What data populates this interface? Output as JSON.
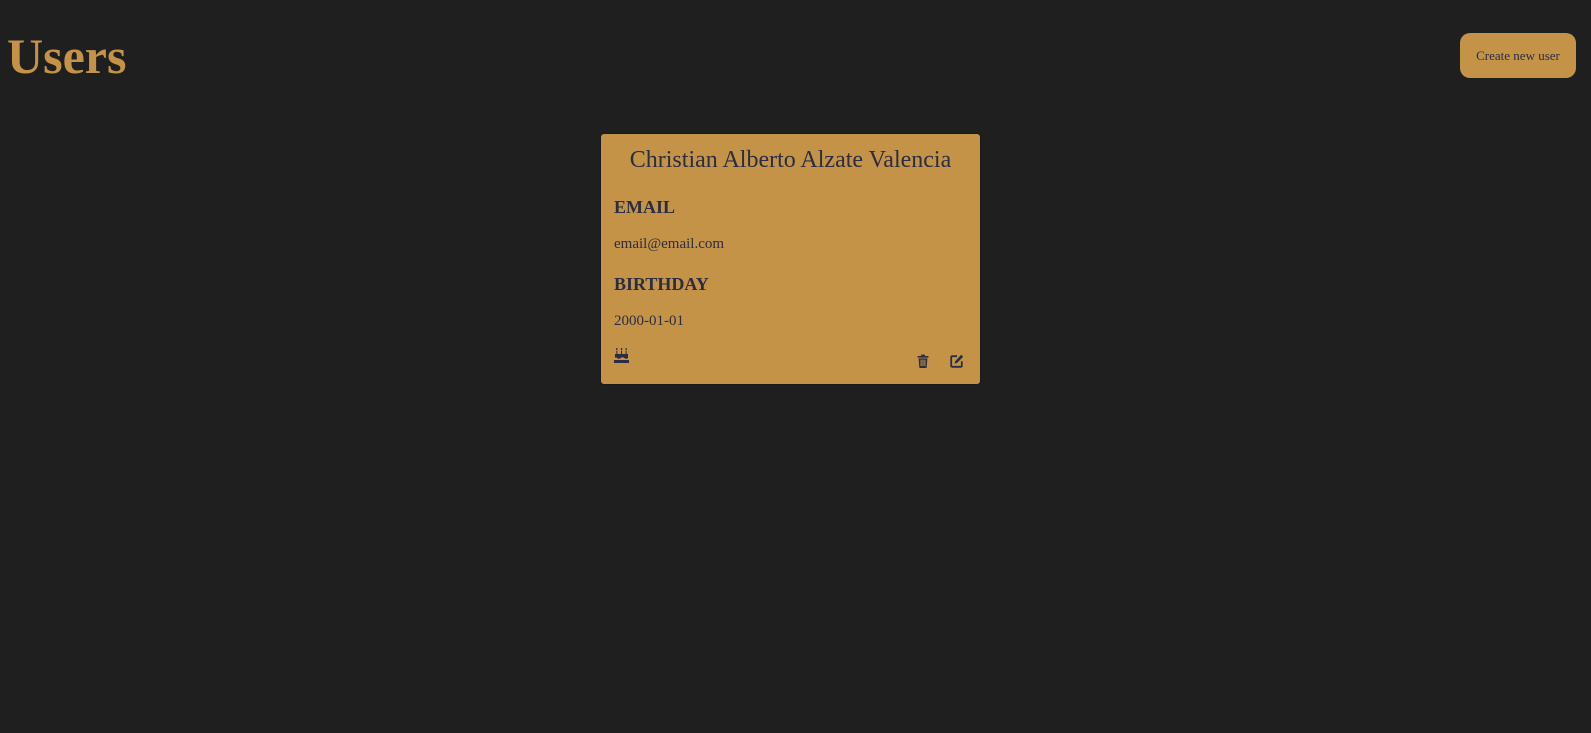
{
  "header": {
    "title": "Users",
    "create_button_label": "Create new user"
  },
  "users": [
    {
      "name": "Christian Alberto Alzate Valencia",
      "email_label": "EMAIL",
      "email": "email@email.com",
      "birthday_label": "BIRTHDAY",
      "birthday": "2000-01-01"
    }
  ],
  "icons": {
    "birthday": "cake-icon",
    "delete": "trash-icon",
    "edit": "edit-icon"
  },
  "colors": {
    "background": "#1f1f1f",
    "accent": "#c49348",
    "text_dark": "#2b2d42"
  }
}
